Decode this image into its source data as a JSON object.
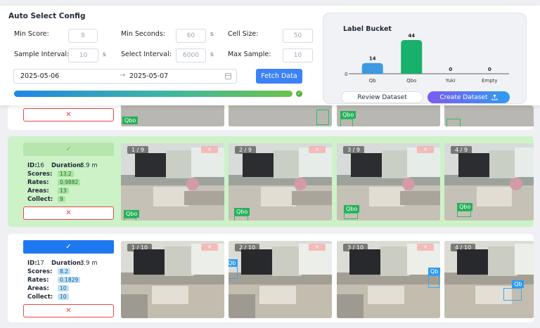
{
  "config": {
    "title": "Auto Select Config",
    "fields": [
      {
        "label": "Min Score:",
        "value": "8",
        "unit": ""
      },
      {
        "label": "Min Seconds:",
        "value": "60",
        "unit": "s"
      },
      {
        "label": "Cell Size:",
        "value": "50",
        "unit": ""
      },
      {
        "label": "Sample Interval:",
        "value": "10",
        "unit": "s"
      },
      {
        "label": "Select Interval:",
        "value": "6000",
        "unit": "s"
      },
      {
        "label": "Max Sample:",
        "value": "10",
        "unit": ""
      }
    ],
    "date_start": "2025-05-06",
    "date_end": "2025-05-07",
    "fetch_label": "Fetch Data",
    "progress": 1.0,
    "colors": {
      "accent": "#3b82f6",
      "success": "#52b13a",
      "danger": "#ef4444"
    }
  },
  "bucket": {
    "title": "Label Bucket",
    "review_label": "Review Dataset",
    "create_label": "Create Dataset",
    "chart_data": {
      "type": "bar",
      "categories": [
        "Qb",
        "Qbo",
        "Yuki",
        "Empty"
      ],
      "values": [
        14,
        44,
        0,
        0
      ],
      "colors": [
        "#3b9ae1",
        "#18b06a",
        "#888888",
        "#888888"
      ],
      "baseline_label": "0"
    }
  },
  "cards": [
    {
      "selected": true,
      "id": "16",
      "duration": "8.9 m",
      "scores": "13.2",
      "rates": "0.9882",
      "areas": "13",
      "collect": "9",
      "thumbs": [
        {
          "counter": "1 / 9",
          "label": "Qbo"
        },
        {
          "counter": "2 / 9",
          "label": "Qbo"
        },
        {
          "counter": "3 / 9",
          "label": "Qbo"
        },
        {
          "counter": "4 / 9",
          "label": "Qbo"
        }
      ]
    },
    {
      "selected": false,
      "id": "17",
      "duration": "3.9 m",
      "scores": "8.2",
      "rates": "0.1829",
      "areas": "10",
      "collect": "10",
      "thumbs": [
        {
          "counter": "1 / 10",
          "label": ""
        },
        {
          "counter": "2 / 10",
          "label": "Qb"
        },
        {
          "counter": "3 / 10",
          "label": "Qb"
        },
        {
          "counter": "4 / 10",
          "label": "Qb"
        }
      ]
    }
  ],
  "labels": {
    "id": "ID:",
    "duration": "Duration:",
    "scores": "Scores:",
    "rates": "Rates:",
    "areas": "Areas:",
    "collect": "Collect:",
    "prev_card_tag": "Qbo"
  },
  "icons": {
    "check": "✓",
    "close": "✕",
    "arrow": "→",
    "upload": "upload-icon",
    "calendar": "calendar-icon"
  }
}
